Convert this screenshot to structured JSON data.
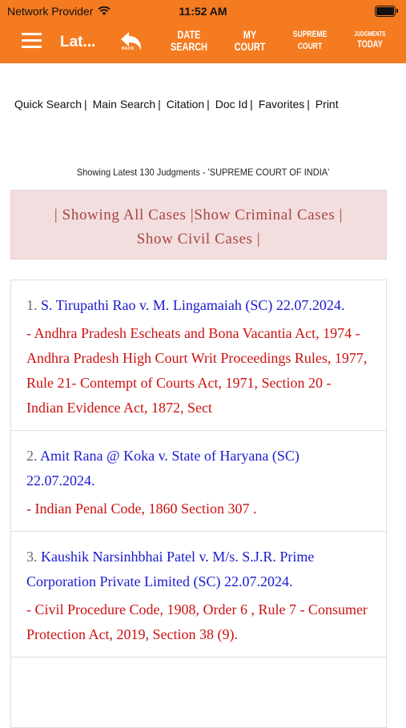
{
  "status": {
    "carrier": "Network Provider",
    "time": "11:52 AM"
  },
  "toolbar": {
    "title": "Lat...",
    "back_label": "BACK",
    "nav": [
      {
        "line1": "DATE",
        "line2": "SEARCH"
      },
      {
        "line1": "MY",
        "line2": "COURT"
      },
      {
        "line1": "SUPREME",
        "line2": "COURT"
      },
      {
        "line1": "JUDGMENTS",
        "line2": "TODAY"
      }
    ]
  },
  "search_links": [
    "Quick Search",
    "Main Search",
    "Citation",
    "Doc Id",
    "Favorites",
    "Print"
  ],
  "showing_text": "Showing Latest 130 Judgments - 'SUPREME COURT OF INDIA'",
  "filter": {
    "line1": "| Showing All Cases |Show Criminal Cases |",
    "line2": "Show Civil Cases |"
  },
  "judgments": [
    {
      "num": "1.",
      "title": "S. Tirupathi Rao v. M. Lingamaiah (SC) 22.07.2024.",
      "subject": "- Andhra Pradesh Escheats and Bona Vacantia Act, 1974 - Andhra Pradesh High Court Writ Proceedings Rules, 1977, Rule 21- Contempt of Courts Act, 1971, Section 20 - Indian Evidence Act, 1872, Sect"
    },
    {
      "num": "2.",
      "title": "Amit Rana @ Koka v. State of Haryana (SC) 22.07.2024.",
      "subject": "- Indian Penal Code, 1860 Section 307 ."
    },
    {
      "num": "3.",
      "title": "Kaushik Narsinhbhai Patel v. M/s. S.J.R. Prime Corporation Private Limited (SC) 22.07.2024.",
      "subject": "- Civil Procedure Code, 1908, Order 6 , Rule 7 - Consumer Protection Act, 2019, Section 38 (9)."
    }
  ],
  "colors": {
    "header": "#f47b20",
    "filter_bg": "#f2dede",
    "filter_text": "#a94442",
    "case_title": "#1a1ad0",
    "case_subject": "#cc1111"
  }
}
